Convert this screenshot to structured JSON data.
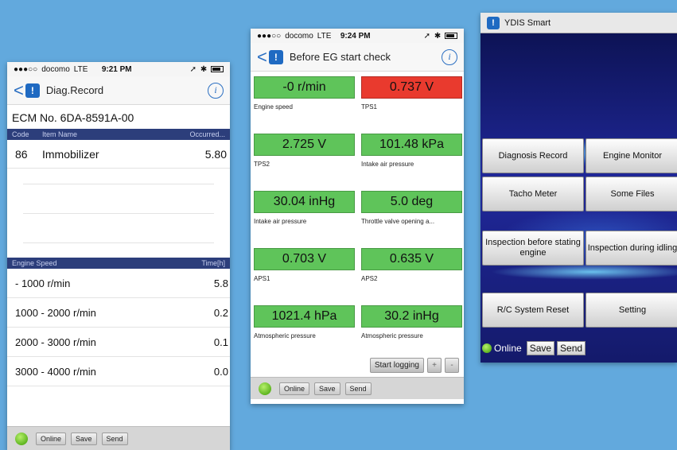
{
  "phone1": {
    "status": {
      "carrier": "docomo",
      "network": "LTE",
      "time": "9:21 PM"
    },
    "nav": {
      "title": "Diag.Record"
    },
    "ecm": "ECM No.  6DA-8591A-00",
    "table1": {
      "headers": {
        "code": "Code",
        "name": "Item Name",
        "occurred": "Occurred..."
      },
      "rows": [
        {
          "code": "86",
          "name": "Immobilizer",
          "value": "5.80"
        }
      ]
    },
    "table2": {
      "headers": {
        "speed": "Engine Speed",
        "time": "Time[h]"
      },
      "rows": [
        {
          "range": "- 1000 r/min",
          "value": "5.8"
        },
        {
          "range": "1000 - 2000 r/min",
          "value": "0.2"
        },
        {
          "range": "2000 - 3000 r/min",
          "value": "0.1"
        },
        {
          "range": "3000 - 4000 r/min",
          "value": "0.0"
        }
      ]
    },
    "bottom": {
      "online": "Online",
      "save": "Save",
      "send": "Send"
    }
  },
  "phone2": {
    "status": {
      "carrier": "docomo",
      "network": "LTE",
      "time": "9:24 PM"
    },
    "nav": {
      "title": "Before EG start check"
    },
    "readings": [
      {
        "value": "-0 r/min",
        "label": "Engine speed",
        "color": "#5fc45a"
      },
      {
        "value": "0.737 V",
        "label": "TPS1",
        "color": "#e93a2e"
      },
      {
        "value": "2.725 V",
        "label": "TPS2",
        "color": "#5fc45a"
      },
      {
        "value": "101.48 kPa",
        "label": "Intake air pressure",
        "color": "#5fc45a"
      },
      {
        "value": "30.04 inHg",
        "label": "Intake air pressure",
        "color": "#5fc45a"
      },
      {
        "value": "5.0 deg",
        "label": "Throttle valve opening a...",
        "color": "#5fc45a"
      },
      {
        "value": "0.703 V",
        "label": "APS1",
        "color": "#5fc45a"
      },
      {
        "value": "0.635 V",
        "label": "APS2",
        "color": "#5fc45a"
      },
      {
        "value": "1021.4 hPa",
        "label": "Atmospheric pressure",
        "color": "#5fc45a"
      },
      {
        "value": "30.2 inHg",
        "label": "Atmospheric pressure",
        "color": "#5fc45a"
      }
    ],
    "logging": {
      "start": "Start logging",
      "plus": "+",
      "minus": "-"
    },
    "bottom": {
      "online": "Online",
      "save": "Save",
      "send": "Send"
    }
  },
  "tablet": {
    "title": "YDIS Smart",
    "buttons": {
      "diagnosis_record": "Diagnosis Record",
      "engine_monitor": "Engine Monitor",
      "tacho_meter": "Tacho Meter",
      "some_files": "Some Files",
      "inspection_before": "Inspection before stating engine",
      "inspection_during": "Inspection during idling",
      "rc_reset": "R/C System Reset",
      "setting": "Setting"
    },
    "bottom": {
      "online": "Online",
      "save": "Save",
      "send": "Send"
    }
  }
}
